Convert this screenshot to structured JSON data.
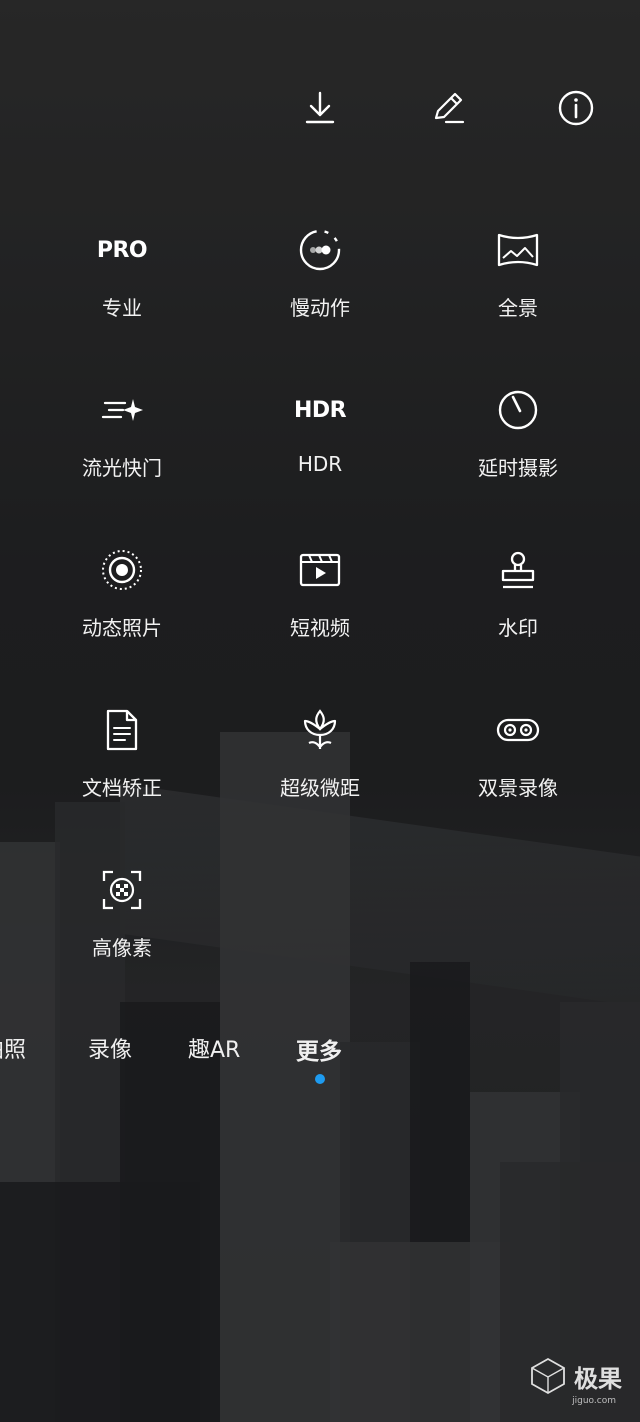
{
  "toolbar": {
    "download_icon": "download-icon",
    "edit_icon": "edit-icon",
    "info_icon": "info-icon"
  },
  "modes": [
    {
      "key": "pro",
      "icon_text": "PRO",
      "label": "专业"
    },
    {
      "key": "slow-motion",
      "icon": "slow-motion-icon",
      "label": "慢动作"
    },
    {
      "key": "panorama",
      "icon": "panorama-icon",
      "label": "全景"
    },
    {
      "key": "light-painting",
      "icon": "light-painting-icon",
      "label": "流光快门"
    },
    {
      "key": "hdr",
      "icon_text": "HDR",
      "label": "HDR"
    },
    {
      "key": "time-lapse",
      "icon": "timer-icon",
      "label": "延时摄影"
    },
    {
      "key": "moving-picture",
      "icon": "moving-picture-icon",
      "label": "动态照片"
    },
    {
      "key": "short-video",
      "icon": "short-video-icon",
      "label": "短视频"
    },
    {
      "key": "watermark",
      "icon": "stamp-icon",
      "label": "水印"
    },
    {
      "key": "document-scan",
      "icon": "document-icon",
      "label": "文档矫正"
    },
    {
      "key": "super-macro",
      "icon": "flower-icon",
      "label": "超级微距"
    },
    {
      "key": "dual-view",
      "icon": "dual-view-icon",
      "label": "双景录像"
    },
    {
      "key": "high-res",
      "icon": "high-res-icon",
      "label": "高像素"
    }
  ],
  "modebar": {
    "items": [
      "拍照",
      "录像",
      "趣AR",
      "更多"
    ],
    "active_index": 3,
    "active_dot_color": "#1e9bf0"
  },
  "watermark": {
    "text": "极果",
    "sub": "jiguo.com"
  }
}
